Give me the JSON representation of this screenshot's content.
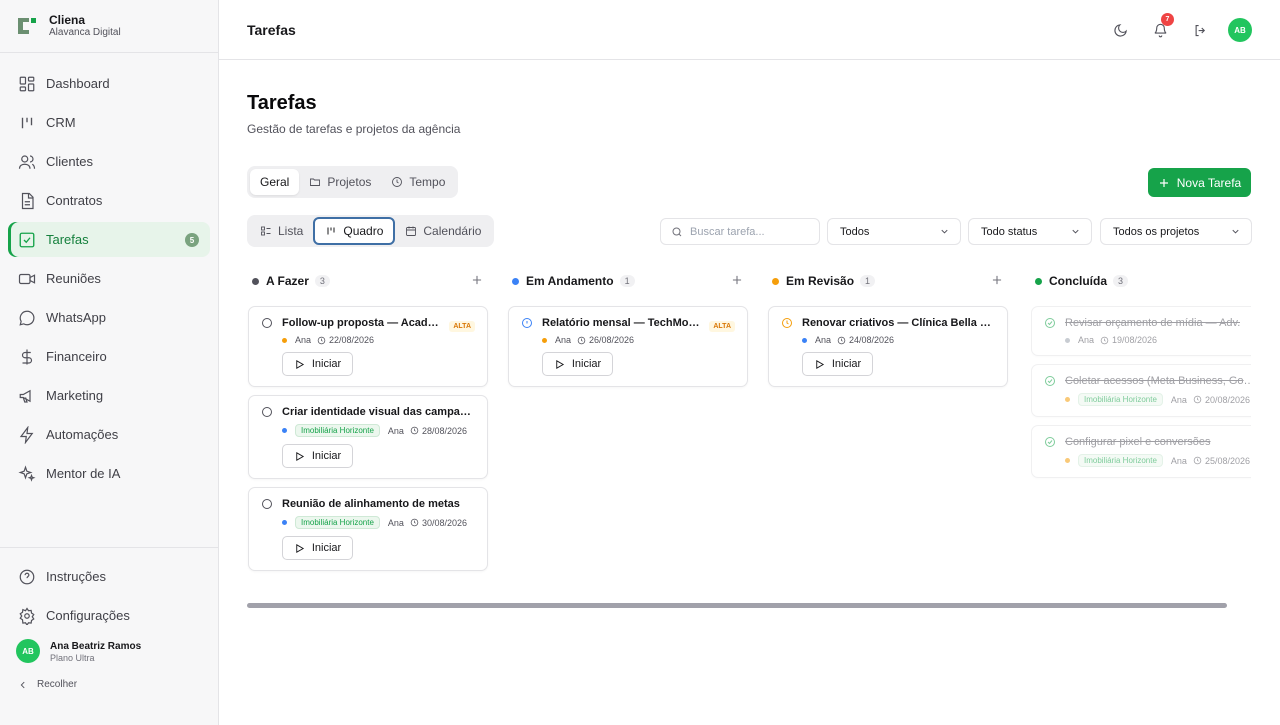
{
  "brand": {
    "name": "Cliena",
    "sub": "Alavanca Digital"
  },
  "nav": [
    {
      "label": "Dashboard",
      "icon": "dashboard-icon"
    },
    {
      "label": "CRM",
      "icon": "kanban-icon"
    },
    {
      "label": "Clientes",
      "icon": "users-icon"
    },
    {
      "label": "Contratos",
      "icon": "document-icon"
    },
    {
      "label": "Tarefas",
      "icon": "checkbox-icon",
      "badge": "5",
      "active": true
    },
    {
      "label": "Reuniões",
      "icon": "video-icon"
    },
    {
      "label": "WhatsApp",
      "icon": "chat-icon"
    },
    {
      "label": "Financeiro",
      "icon": "dollar-icon"
    },
    {
      "label": "Marketing",
      "icon": "megaphone-icon"
    },
    {
      "label": "Automações",
      "icon": "zap-icon"
    },
    {
      "label": "Mentor de IA",
      "icon": "sparkles-icon"
    }
  ],
  "bottom_nav": [
    {
      "label": "Instruções",
      "icon": "help-icon"
    },
    {
      "label": "Configurações",
      "icon": "gear-icon"
    }
  ],
  "user": {
    "initials": "AB",
    "name": "Ana Beatriz Ramos",
    "plan": "Plano Ultra"
  },
  "collapse_label": "Recolher",
  "topbar": {
    "title": "Tarefas",
    "notifications": "7",
    "avatar": "AB"
  },
  "page": {
    "title": "Tarefas",
    "subtitle": "Gestão de tarefas e projetos da agência"
  },
  "tabs": [
    "Geral",
    "Projetos",
    "Tempo"
  ],
  "views": [
    "Lista",
    "Quadro",
    "Calendário"
  ],
  "new_task_label": "Nova Tarefa",
  "search": {
    "placeholder": "Buscar tarefa..."
  },
  "filters": [
    "Todos",
    "Todo status",
    "Todos os projetos"
  ],
  "start_label": "Iniciar",
  "priority_label": "ALTA",
  "columns": [
    {
      "title": "A Fazer",
      "count": "3",
      "color": "#52525b",
      "cards": [
        {
          "title": "Follow-up proposta — Academia",
          "priority": true,
          "assignee": "Ana",
          "date": "22/08/2026",
          "dot": "#f59e0b"
        },
        {
          "title": "Criar identidade visual das campanhas",
          "project": "Imobiliária Horizonte",
          "assignee": "Ana",
          "date": "28/08/2026",
          "dot": "#3b82f6"
        },
        {
          "title": "Reunião de alinhamento de metas",
          "project": "Imobiliária Horizonte",
          "assignee": "Ana",
          "date": "30/08/2026",
          "dot": "#3b82f6"
        }
      ]
    },
    {
      "title": "Em Andamento",
      "count": "1",
      "color": "#3b82f6",
      "cards": [
        {
          "title": "Relatório mensal — TechMotors",
          "priority": true,
          "assignee": "Ana",
          "date": "26/08/2026",
          "dot": "#f59e0b"
        }
      ]
    },
    {
      "title": "Em Revisão",
      "count": "1",
      "color": "#f59e0b",
      "cards": [
        {
          "title": "Renovar criativos — Clínica Bella Derma",
          "assignee": "Ana",
          "date": "24/08/2026",
          "dot": "#3b82f6"
        }
      ]
    },
    {
      "title": "Concluída",
      "count": "3",
      "color": "#16a34a",
      "cards": [
        {
          "title": "Revisar orçamento de mídia — Adv.",
          "assignee": "Ana",
          "date": "19/08/2026",
          "dot": "#9ca3af"
        },
        {
          "title": "Coletar acessos (Meta Business, Google)",
          "project": "Imobiliária Horizonte",
          "assignee": "Ana",
          "date": "20/08/2026",
          "dot": "#f59e0b"
        },
        {
          "title": "Configurar pixel e conversões",
          "project": "Imobiliária Horizonte",
          "assignee": "Ana",
          "date": "25/08/2026",
          "dot": "#f59e0b"
        }
      ]
    }
  ]
}
